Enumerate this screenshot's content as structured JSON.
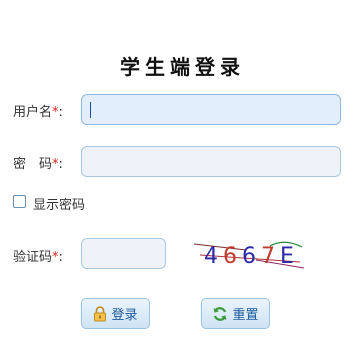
{
  "title": "学生端登录",
  "form": {
    "username_label": "用户名",
    "password_label": "密　码",
    "captcha_label": "验证码",
    "required_mark": "*",
    "colon": ":",
    "username_value": "",
    "password_value": "",
    "captcha_value": "",
    "show_password_label": "显示密码",
    "show_password_checked": false
  },
  "captcha_image": {
    "text": "4667E",
    "colors": [
      "#2a2aa8",
      "#c0392b",
      "#2a2aa8",
      "#c0392b",
      "#2a2aa8"
    ]
  },
  "buttons": {
    "login_label": "登录",
    "reset_label": "重置"
  },
  "icons": {
    "login": "lock-icon",
    "reset": "refresh-icon"
  }
}
